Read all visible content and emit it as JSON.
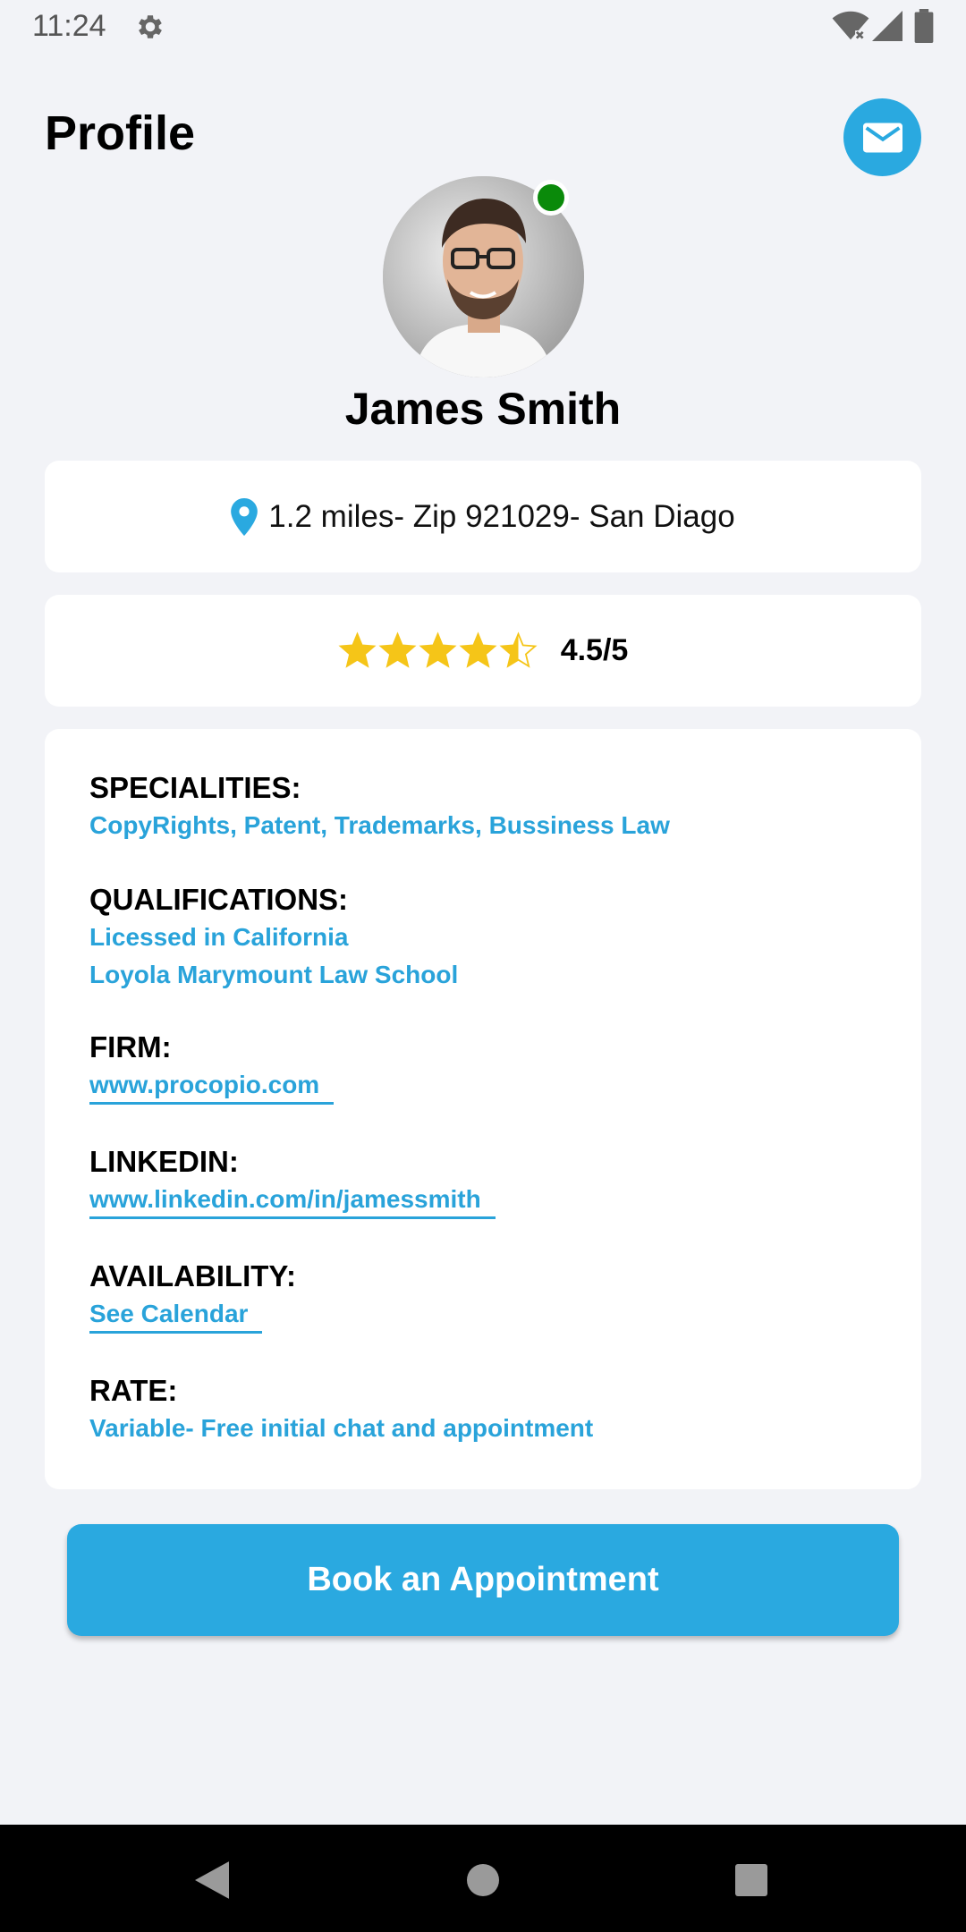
{
  "status_bar": {
    "time": "11:24",
    "icons": [
      "gear-icon",
      "wifi-icon",
      "signal-icon",
      "battery-icon"
    ]
  },
  "header": {
    "title": "Profile",
    "mail_icon": "mail-icon"
  },
  "profile": {
    "name": "James Smith",
    "online": true,
    "location": "1.2 miles- Zip 921029- San Diago",
    "rating_value": 4.5,
    "rating_text": "4.5/5"
  },
  "details": {
    "specialities": {
      "label": "SPECIALITIES:",
      "value": "CopyRights, Patent, Trademarks, Bussiness Law"
    },
    "qualifications": {
      "label": "QUALIFICATIONS:",
      "line1": "Licessed in California",
      "line2": "Loyola Marymount Law School"
    },
    "firm": {
      "label": "FIRM:",
      "value": "www.procopio.com"
    },
    "linkedin": {
      "label": "LINKEDIN:",
      "value": "www.linkedin.com/in/jamessmith"
    },
    "availability": {
      "label": "AVAILABILITY:",
      "value": "See Calendar"
    },
    "rate": {
      "label": "RATE:",
      "value": "Variable- Free initial chat and appointment"
    }
  },
  "actions": {
    "book_label": "Book an Appointment"
  },
  "colors": {
    "accent": "#2aa9e0",
    "link": "#29a3da",
    "star": "#f5c518",
    "online": "#0a8a0a",
    "background": "#f2f3f7"
  }
}
